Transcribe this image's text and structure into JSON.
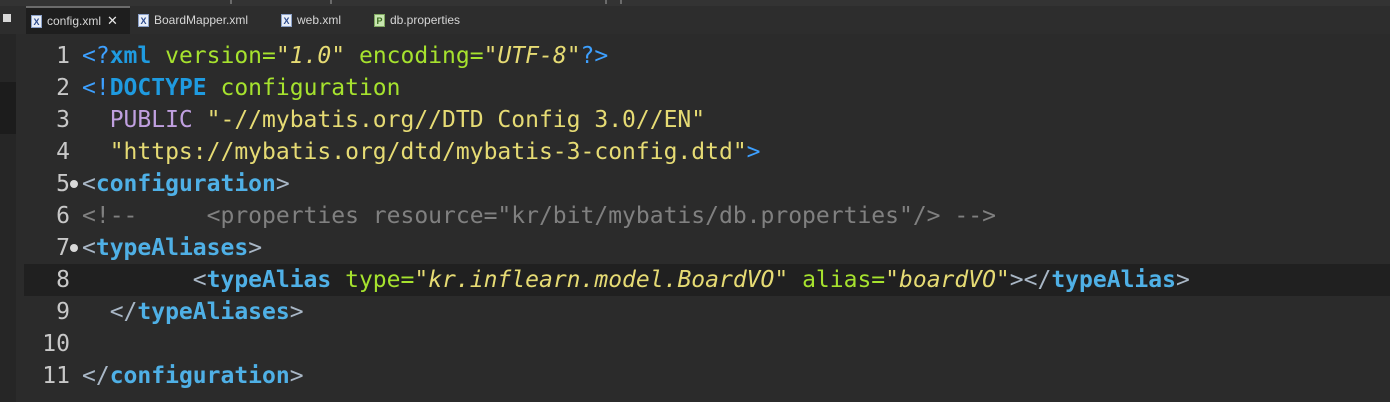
{
  "tabs": [
    {
      "label": "config.xml",
      "icon": "xml-file-icon",
      "active": true,
      "close": "✕"
    },
    {
      "label": "BoardMapper.xml",
      "icon": "xml-file-icon",
      "active": false
    },
    {
      "label": "web.xml",
      "icon": "xml-file-icon",
      "active": false
    },
    {
      "label": "db.properties",
      "icon": "properties-file-icon",
      "active": false
    }
  ],
  "tab_icons": {
    "xml": "X",
    "properties": "P"
  },
  "editor": {
    "line_numbers": [
      "1",
      "2",
      "3",
      "4",
      "5",
      "6",
      "7",
      "8",
      "9",
      "10",
      "11"
    ],
    "current_line": "8",
    "lines": [
      [
        [
          "pi",
          "<?"
        ],
        [
          "kw",
          "xml"
        ],
        [
          "attr",
          " version="
        ],
        [
          "sval",
          "\"1.0\""
        ],
        [
          "attr",
          " encoding="
        ],
        [
          "sval",
          "\"UTF-8\""
        ],
        [
          "pi",
          "?>"
        ]
      ],
      [
        [
          "pi",
          "<!"
        ],
        [
          "kw",
          "DOCTYPE"
        ],
        [
          "txt",
          " configuration"
        ]
      ],
      [
        [
          "dec",
          "  PUBLIC "
        ],
        [
          "sval2",
          "\"-//mybatis.org//DTD Config 3.0//EN\""
        ]
      ],
      [
        [
          "sval2",
          "  \"https://mybatis.org/dtd/mybatis-3-config.dtd\""
        ],
        [
          "pi",
          ">"
        ]
      ],
      [
        [
          "punc",
          "<"
        ],
        [
          "tagc",
          "configuration"
        ],
        [
          "punc",
          ">"
        ]
      ],
      [
        [
          "cmt",
          "<!--     <properties resource=\"kr/bit/mybatis/db.properties\"/> -->"
        ]
      ],
      [
        [
          "punc",
          "<"
        ],
        [
          "tagc",
          "typeAliases"
        ],
        [
          "punc",
          ">"
        ]
      ],
      [
        [
          "punc",
          "        <"
        ],
        [
          "tagc",
          "typeAlias"
        ],
        [
          "attr",
          " type="
        ],
        [
          "sval",
          "\"kr.inflearn.model.BoardVO\""
        ],
        [
          "attr",
          " alias="
        ],
        [
          "sval",
          "\"boardVO\""
        ],
        [
          "punc",
          "></"
        ],
        [
          "tagc",
          "typeAlias"
        ],
        [
          "punc",
          ">"
        ]
      ],
      [
        [
          "punc",
          "  </"
        ],
        [
          "tagc",
          "typeAliases"
        ],
        [
          "punc",
          ">"
        ]
      ],
      [],
      [
        [
          "punc",
          "</"
        ],
        [
          "tagc",
          "configuration"
        ],
        [
          "punc",
          ">"
        ]
      ]
    ]
  }
}
